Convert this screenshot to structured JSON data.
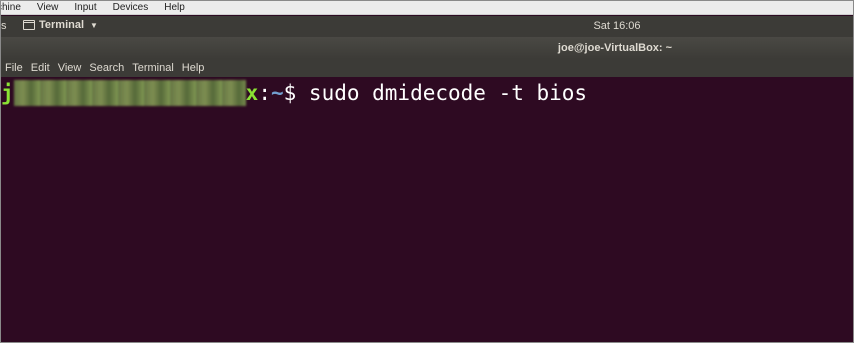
{
  "vbox_menu": {
    "items": [
      "chine",
      "View",
      "Input",
      "Devices",
      "Help"
    ]
  },
  "top_panel": {
    "activities_label": "s",
    "app_name": "Terminal",
    "clock": "Sat 16:06"
  },
  "window": {
    "title": "joe@joe-VirtualBox: ~"
  },
  "term_menu": {
    "items": [
      "File",
      "Edit",
      "View",
      "Search",
      "Terminal",
      "Help"
    ]
  },
  "terminal": {
    "user_initial": "j",
    "host_suffix": "x",
    "path_sep": ":",
    "path": "~",
    "prompt_symbol": "$",
    "command": " sudo dmidecode -t bios"
  },
  "colors": {
    "terminal_bg": "#2e0a22",
    "prompt_user": "#8ae234",
    "prompt_path": "#729fcf",
    "panel_bg": "#3c3b37"
  }
}
